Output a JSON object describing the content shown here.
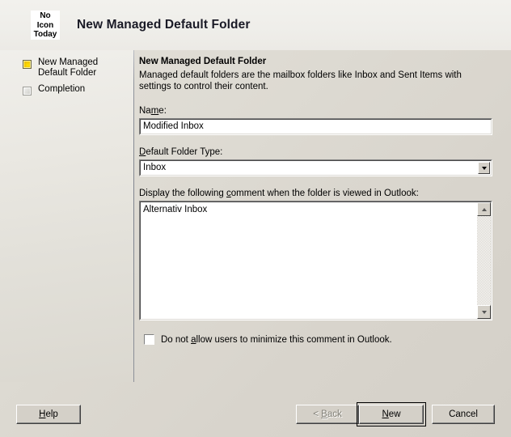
{
  "window": {
    "title": "New Managed Default Folder"
  },
  "header": {
    "icon_line1": "No",
    "icon_line2": "Icon",
    "icon_line3": "Today",
    "title": "New Managed Default Folder"
  },
  "sidebar": {
    "steps": [
      {
        "label": "New Managed Default Folder",
        "state": "active"
      },
      {
        "label": "Completion",
        "state": "inactive"
      }
    ]
  },
  "main": {
    "pane_title": "New Managed Default Folder",
    "pane_description": "Managed default folders are the mailbox folders like Inbox and Sent Items with settings to control their content.",
    "name_label_before": "Na",
    "name_label_accel": "m",
    "name_label_after": "e:",
    "name_value": "Modified Inbox",
    "folder_type_label_accel": "D",
    "folder_type_label_after": "efault Folder Type:",
    "folder_type_value": "Inbox",
    "comment_label_before": "Display the following ",
    "comment_label_accel": "c",
    "comment_label_after": "omment when the folder is viewed in Outlook:",
    "comment_value": "Alternativ Inbox",
    "minimize_label_before": "Do not ",
    "minimize_label_accel": "a",
    "minimize_label_after": "llow users to minimize this comment in Outlook.",
    "minimize_checked": false
  },
  "buttons": {
    "help_accel": "H",
    "help_after": "elp",
    "back_before": "< ",
    "back_accel": "B",
    "back_after": "ack",
    "back_disabled": true,
    "new_accel": "N",
    "new_after": "ew",
    "new_is_default": true,
    "cancel": "Cancel"
  },
  "colors": {
    "dialog_background": "#d4d0c8",
    "header_background": "#f0efeb",
    "field_background": "#ffffff",
    "active_step_marker": "#f3c900",
    "inactive_step_marker": "#dcdcd8",
    "disabled_text": "#828077",
    "divider": "#7d828c"
  }
}
